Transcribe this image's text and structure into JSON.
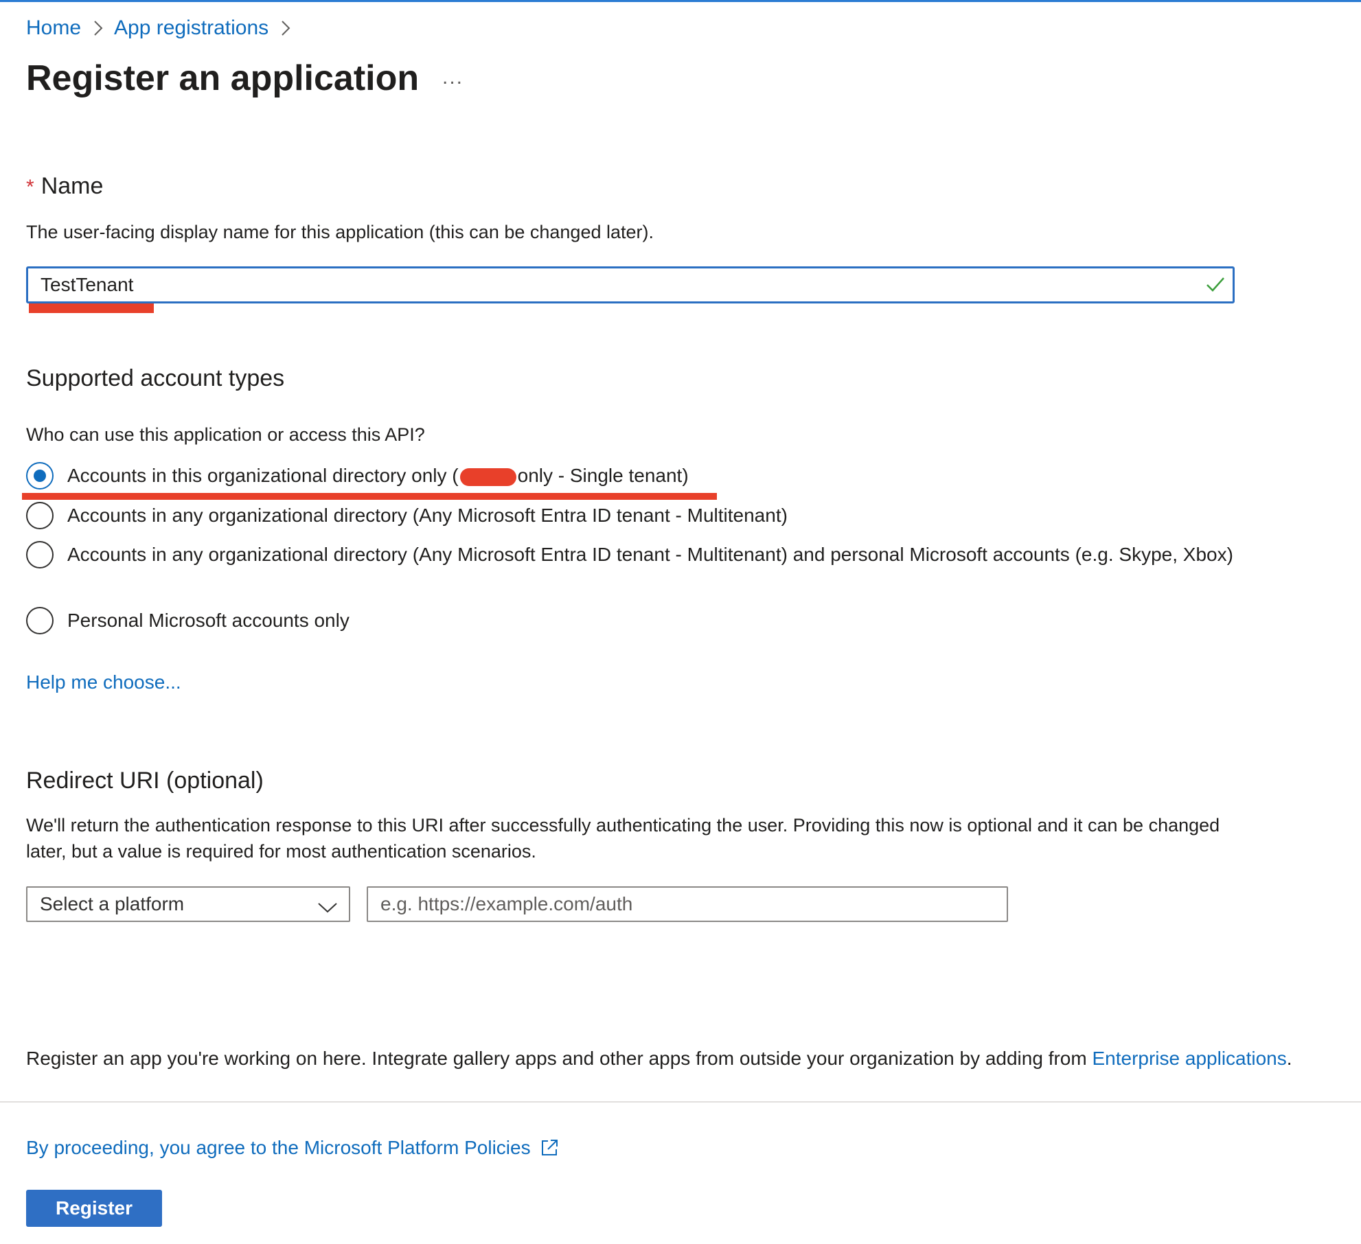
{
  "breadcrumb": {
    "home": "Home",
    "app_registrations": "App registrations"
  },
  "page": {
    "title": "Register an application",
    "more_label": "..."
  },
  "name_section": {
    "required_marker": "*",
    "label": "Name",
    "description": "The user-facing display name for this application (this can be changed later).",
    "value": "TestTenant"
  },
  "account_types": {
    "heading": "Supported account types",
    "question": "Who can use this application or access this API?",
    "options": [
      {
        "label_before": "Accounts in this organizational directory only (",
        "label_after": "only - Single tenant)",
        "checked": true
      },
      {
        "label": "Accounts in any organizational directory (Any Microsoft Entra ID tenant - Multitenant)",
        "checked": false
      },
      {
        "label": "Accounts in any organizational directory (Any Microsoft Entra ID tenant - Multitenant) and personal Microsoft accounts (e.g. Skype, Xbox)",
        "checked": false
      },
      {
        "label": "Personal Microsoft accounts only",
        "checked": false
      }
    ],
    "help_link": "Help me choose..."
  },
  "redirect": {
    "heading": "Redirect URI (optional)",
    "description": "We'll return the authentication response to this URI after successfully authenticating the user. Providing this now is optional and it can be changed later, but a value is required for most authentication scenarios.",
    "platform_select": "Select a platform",
    "uri_placeholder": "e.g. https://example.com/auth"
  },
  "footer": {
    "note_text": "Register an app you're working on here. Integrate gallery apps and other apps from outside your organization by adding from ",
    "note_link": "Enterprise applications",
    "note_end": ".",
    "policy_link": "By proceeding, you agree to the Microsoft Platform Policies",
    "register_label": "Register"
  },
  "icons": {
    "breadcrumb_sep": "chevron-right-icon",
    "valid": "checkmark-icon",
    "dropdown": "chevron-down-icon",
    "external": "external-link-icon"
  },
  "colors": {
    "accent": "#0f6cbd",
    "button": "#2f6fc4",
    "required": "#d13438",
    "valid": "#3b9e3b",
    "annotation": "#e8402a"
  }
}
